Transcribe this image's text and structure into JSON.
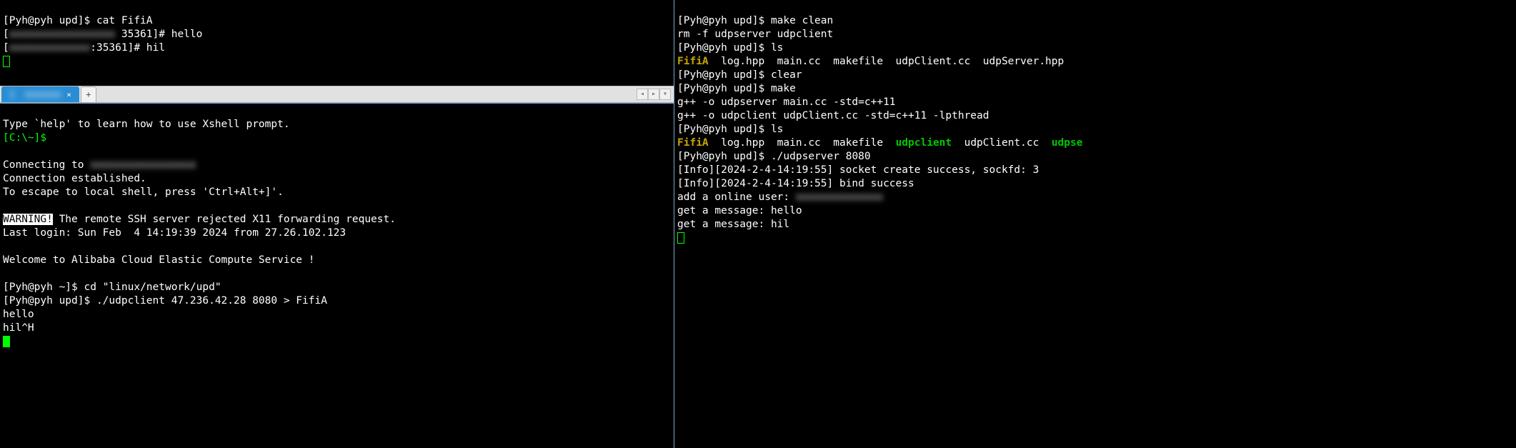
{
  "left_top": {
    "prompt1_user": "[Pyh@pyh upd]$ ",
    "prompt1_cmd": "cat FifiA",
    "line2_a": "[",
    "line2_blur": "xxxxxxxxxxxxxxxxx",
    "line2_b": " 35361]# hello",
    "line3_a": "[",
    "line3_blur": "xxxxxxxxxxxxx",
    "line3_b": ":35361]# hil"
  },
  "tabbar": {
    "tab_label": "1  xxxxxxx",
    "tab_close": "×",
    "add": "+",
    "nav_l": "◂",
    "nav_r": "▸",
    "nav_d": "▾"
  },
  "left_bottom": {
    "help": "Type `help' to learn how to use Xshell prompt.",
    "local_prompt": "[C:\\~]$ ",
    "conn_a": "Connecting to ",
    "conn_blur": "xxxxxxxxxxxxxxxxx",
    "conn_est": "Connection established.",
    "escape": "To escape to local shell, press 'Ctrl+Alt+]'.",
    "warn": "WARNING!",
    "warn_rest": " The remote SSH server rejected X11 forwarding request.",
    "lastlogin": "Last login: Sun Feb  4 14:19:39 2024 from 27.26.102.123",
    "welcome": "Welcome to Alibaba Cloud Elastic Compute Service !",
    "p1_user": "[Pyh@pyh ~]$ ",
    "p1_cmd": "cd \"linux/network/upd\"",
    "p2_user": "[Pyh@pyh upd]$ ",
    "p2_cmd": "./udpclient 47.236.42.28 8080 > FifiA",
    "p2_out1": "hello",
    "p2_out2": "hil^H"
  },
  "right": {
    "p1_user": "[Pyh@pyh upd]$ ",
    "p1_cmd": "make clean",
    "rm": "rm -f udpserver udpclient",
    "p2_user": "[Pyh@pyh upd]$ ",
    "p2_cmd": "ls",
    "ls1_fifia": "FifiA",
    "ls1_rest": "  log.hpp  main.cc  makefile  udpClient.cc  udpServer.hpp",
    "p3_user": "[Pyh@pyh upd]$ ",
    "p3_cmd": "clear",
    "p4_user": "[Pyh@pyh upd]$ ",
    "p4_cmd": "make",
    "gpp1": "g++ -o udpserver main.cc -std=c++11",
    "gpp2": "g++ -o udpclient udpClient.cc -std=c++11 -lpthread",
    "p5_user": "[Pyh@pyh upd]$ ",
    "p5_cmd": "ls",
    "ls2_fifia": "FifiA",
    "ls2_mid": "  log.hpp  main.cc  makefile  ",
    "ls2_exe1": "udpclient",
    "ls2_sep": "  udpClient.cc  ",
    "ls2_exe2": "udpse",
    "p6_user": "[Pyh@pyh upd]$ ",
    "p6_cmd": "./udpserver 8080",
    "info1": "[Info][2024-2-4-14:19:55] socket create success, sockfd: 3",
    "info2": "[Info][2024-2-4-14:19:55] bind success",
    "add_a": "add a online user: ",
    "add_blur": "xxxxxxxxxxxxxx",
    "msg1": "get a message: hello",
    "msg2": "get a message: hil"
  }
}
